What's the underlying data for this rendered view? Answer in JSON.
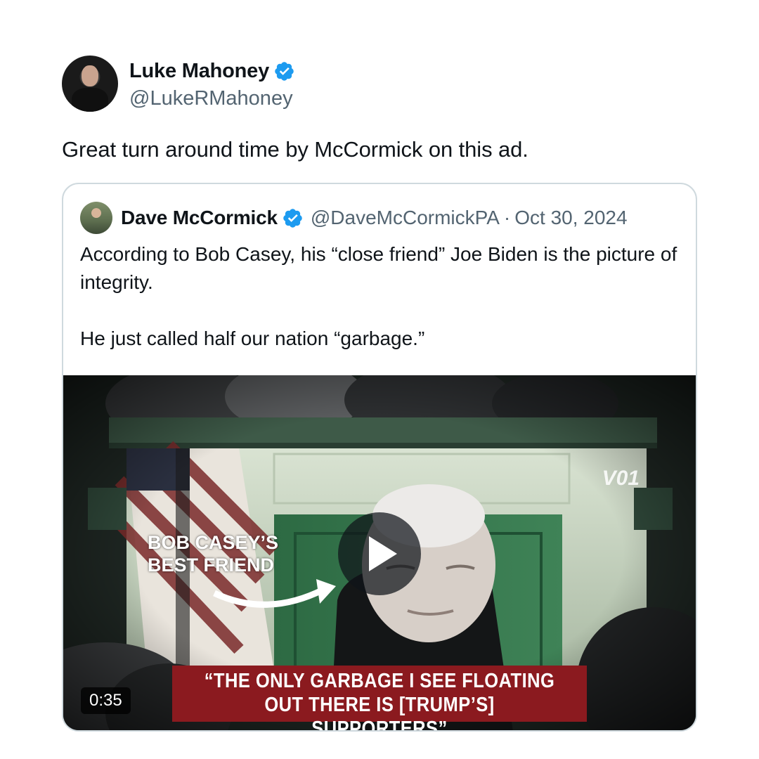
{
  "author": {
    "display_name": "Luke Mahoney",
    "handle": "@LukeRMahoney",
    "verified_icon": "verified-badge-icon"
  },
  "tweet": {
    "text": "Great turn around time by McCormick on this ad."
  },
  "quote": {
    "display_name": "Dave McCormick",
    "handle": "@DaveMcCormickPA",
    "separator": "·",
    "date": "Oct 30, 2024",
    "paragraph_1": "According to Bob Casey, his “close friend” Joe Biden is the picture of integrity.",
    "paragraph_2": "He just called half our nation “garbage.”",
    "media": {
      "overlay_label_line1": "BOB CASEY’S",
      "overlay_label_line2": "BEST FRIEND",
      "caption_line1": "“THE ONLY GARBAGE I SEE FLOATING",
      "caption_line2": "OUT THERE IS [TRUMP’S] SUPPORTERS”",
      "logo_text": "V01",
      "duration": "0:35",
      "play_icon": "play-icon"
    }
  },
  "colors": {
    "verified_blue": "#1d9bf0",
    "secondary_text": "#536471",
    "border": "#cfd9de",
    "caption_red": "#8b1a1f"
  }
}
